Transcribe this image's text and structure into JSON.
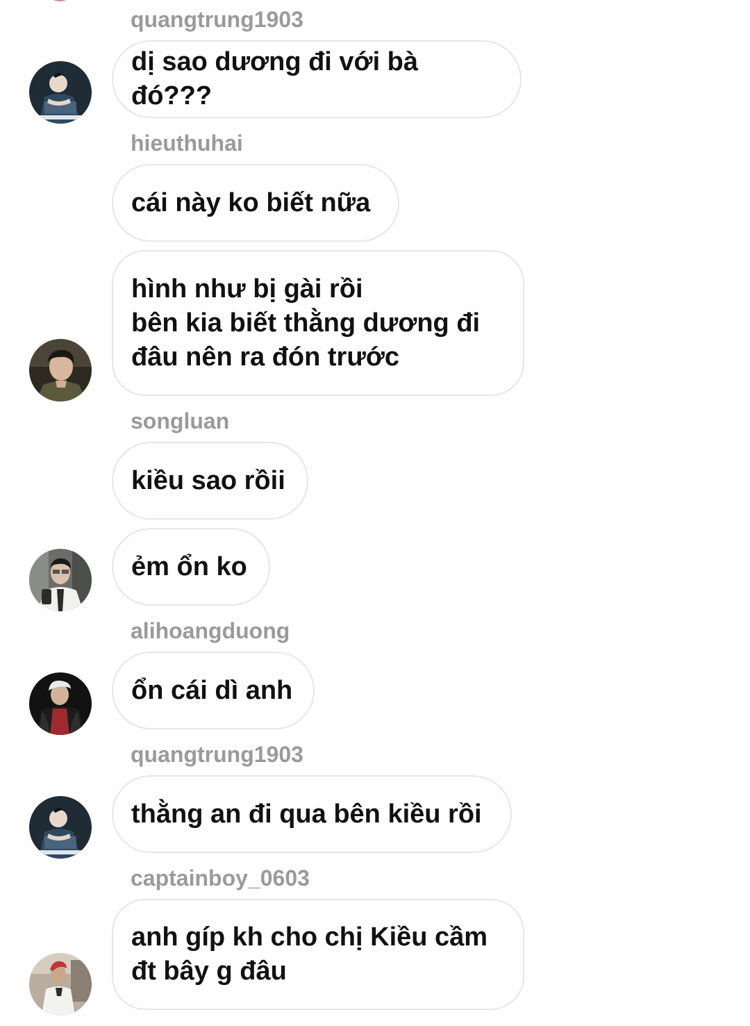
{
  "messages": [
    {
      "sender": "quangtrung1903",
      "text": "dị sao dương đi với bà đó???"
    },
    {
      "sender": "hieuthuhai",
      "text": "cái này ko biết nữa"
    },
    {
      "sender": "",
      "text": "hình như bị gài rồi\nbên kia biết thằng dương đi\nđâu nên ra đón trước"
    },
    {
      "sender": "songluan",
      "text": "kiều sao rồii"
    },
    {
      "sender": "",
      "text": "ẻm ổn ko"
    },
    {
      "sender": "alihoangduong",
      "text": "ổn cái dì anh"
    },
    {
      "sender": "quangtrung1903",
      "text": "thằng an đi qua bên kiều rồi"
    },
    {
      "sender": "captainboy_0603",
      "text": "anh gíp kh cho chị Kiều cầm\nđt bây g đâu"
    }
  ],
  "avatars": [
    {
      "user": "quangtrung1903",
      "icon": "profile-photo"
    },
    {
      "user": "hieuthuhai",
      "icon": "profile-photo"
    },
    {
      "user": "songluan",
      "icon": "profile-photo"
    },
    {
      "user": "alihoangduong",
      "icon": "profile-photo"
    },
    {
      "user": "quangtrung1903",
      "icon": "profile-photo"
    },
    {
      "user": "captainboy_0603",
      "icon": "profile-photo"
    }
  ],
  "colors": {
    "background": "#ffffff",
    "bubble_border": "#e6e6e6",
    "message_text": "#111111",
    "sender_text": "#9a9a9a"
  }
}
